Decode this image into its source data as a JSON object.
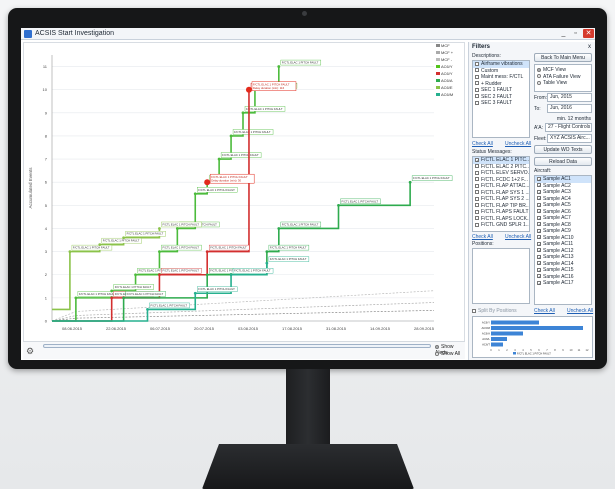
{
  "window": {
    "title": "ACSIS Start Investigation",
    "min": "_",
    "max": "▫",
    "close": "✕"
  },
  "legend": [
    {
      "label": "MCF",
      "color": "#888888"
    },
    {
      "label": "MCF +",
      "color": "#aaaaaa"
    },
    {
      "label": "MCF -",
      "color": "#bbbbbb"
    },
    {
      "label": "AC6/Y",
      "color": "#52c41a"
    },
    {
      "label": "AC6/Y",
      "color": "#d32f2f"
    },
    {
      "label": "AC6/A",
      "color": "#2eab4e"
    },
    {
      "label": "AC6/E",
      "color": "#8bc34a"
    },
    {
      "label": "AC6/M",
      "color": "#26b08f"
    }
  ],
  "chart_data": {
    "type": "line",
    "x_ticks": [
      "08.06.2015",
      "22.06.2015",
      "06.07.2015",
      "20.07.2015",
      "03.08.2015",
      "17.08.2015",
      "31.08.2015",
      "14.09.2015",
      "28.09.2015"
    ],
    "y_ticks": [
      0,
      1,
      2,
      3,
      4,
      5,
      6,
      7,
      8,
      9,
      10,
      11
    ],
    "ylabel": "Accumulated Events",
    "ylim": [
      0,
      11.5
    ],
    "point_label": "F/CTL ELAC 1 PITCH FAULT",
    "annotations": [
      {
        "text": "F/CTL ELAC 1 PITCH FAULT Delay duration (min): 116",
        "x": 33,
        "y": 10
      },
      {
        "text": "F/CTL ELAC 1 PITCH FAULT Delay duration (min): 30",
        "x": 26,
        "y": 6
      }
    ],
    "series": [
      {
        "color": "#4cbb3c",
        "points": [
          [
            0,
            0
          ],
          [
            4,
            1
          ],
          [
            10,
            1.3
          ],
          [
            14,
            2
          ],
          [
            18,
            3
          ],
          [
            21,
            4
          ],
          [
            24,
            5.5
          ],
          [
            26,
            6
          ],
          [
            28,
            7
          ],
          [
            30,
            8
          ],
          [
            32,
            9
          ],
          [
            34,
            10
          ],
          [
            38,
            11
          ]
        ]
      },
      {
        "color": "#d32f2f",
        "points": [
          [
            0,
            0
          ],
          [
            10,
            1
          ],
          [
            18,
            2
          ],
          [
            26,
            3
          ],
          [
            33,
            10
          ]
        ]
      },
      {
        "color": "#8bc34a",
        "points": [
          [
            0,
            0.5
          ],
          [
            3,
            3
          ],
          [
            8,
            3.3
          ],
          [
            12,
            3.6
          ],
          [
            18,
            4
          ]
        ]
      },
      {
        "color": "#2eab4e",
        "points": [
          [
            0,
            0
          ],
          [
            12,
            1
          ],
          [
            26,
            2
          ],
          [
            36,
            3
          ],
          [
            38,
            4
          ],
          [
            48,
            5
          ],
          [
            60,
            6
          ]
        ]
      },
      {
        "color": "#26b08f",
        "points": [
          [
            0,
            0
          ],
          [
            16,
            0.5
          ],
          [
            24,
            1.2
          ],
          [
            30,
            2
          ],
          [
            36,
            2.5
          ]
        ]
      }
    ]
  },
  "bottom": {
    "show_alerts": "Show Alerts",
    "show_all": "Show All"
  },
  "panel": {
    "filters_title": "Filters",
    "filters_close": "x",
    "descriptions_label": "Descriptions:",
    "descriptions": [
      {
        "label": "Airframe vibrations",
        "checked": false,
        "selected": true
      },
      {
        "label": "Custom",
        "checked": false,
        "selected": false
      },
      {
        "label": "Maint mess: F/CTL",
        "checked": false,
        "selected": false
      },
      {
        "label": "+ Rudder",
        "checked": false,
        "selected": false
      },
      {
        "label": "SEC 1 FAULT",
        "checked": false,
        "selected": false
      },
      {
        "label": "SEC 2 FAULT",
        "checked": false,
        "selected": false
      },
      {
        "label": "SEC 3 FAULT",
        "checked": false,
        "selected": false
      }
    ],
    "back_btn": "Back To Main Menu",
    "views": [
      {
        "label": "MCF View",
        "on": true
      },
      {
        "label": "ATA Failure View",
        "on": false
      },
      {
        "label": "Table View",
        "on": false
      }
    ],
    "from_label": "From:",
    "from_value": "Jun, 2015",
    "to_label": "To:",
    "to_value": "Jun, 2016",
    "min_months": "min. 12 months",
    "ata_label": "A'A:",
    "ata_value": "27 - Flight Controls",
    "fleet_label": "Fleet:",
    "fleet_value": "XYZ ACSIS Airc...",
    "check_all": "Check All",
    "uncheck_all": "Uncheck All",
    "update_btn": "Update WO Texts",
    "reload_btn": "Reload Data",
    "status_label": "Status Messages:",
    "status_messages": [
      {
        "label": "F/CTL ELAC 1 PITC...",
        "checked": true
      },
      {
        "label": "F/CTL ELAC 2 PITC...",
        "checked": false
      },
      {
        "label": "F/CTL ELEV SERVO...",
        "checked": false
      },
      {
        "label": "F/CTL FCDC 1+2 F...",
        "checked": false
      },
      {
        "label": "F/CTL FLAP ATTAC...",
        "checked": false
      },
      {
        "label": "F/CTL FLAP SYS 1 ...",
        "checked": false
      },
      {
        "label": "F/CTL FLAP SYS 2 ...",
        "checked": false
      },
      {
        "label": "F/CTL FLAP TIP BR...",
        "checked": false
      },
      {
        "label": "F/CTL FLAPS FAULT",
        "checked": false
      },
      {
        "label": "F/CTL FLAPS LOCK...",
        "checked": false
      },
      {
        "label": "F/CTL GND SPLR 1...",
        "checked": false
      }
    ],
    "aircraft_label": "Aircraft:",
    "aircraft": [
      "Sample AC1",
      "Sample AC2",
      "Sample AC3",
      "Sample AC4",
      "Sample AC5",
      "Sample AC6",
      "Sample AC7",
      "Sample AC8",
      "Sample AC9",
      "Sample AC10",
      "Sample AC11",
      "Sample AC12",
      "Sample AC13",
      "Sample AC14",
      "Sample AC15",
      "Sample AC16",
      "Sample AC17"
    ],
    "positions_label": "Positions:",
    "split_by_positions": "Split By Positions",
    "bar_chart": {
      "type": "bar",
      "categories": [
        "AC6/Y",
        "AC6/M",
        "AC6/A",
        "AC6/L",
        "AC6/T"
      ],
      "values": [
        6,
        11.5,
        4,
        2,
        1.5
      ],
      "x_ticks": [
        0,
        1,
        2,
        3,
        4,
        5,
        6,
        7,
        8,
        9,
        10,
        11,
        12
      ],
      "legend": "F/CTL ELAC 1 PITCH FAULT"
    }
  }
}
